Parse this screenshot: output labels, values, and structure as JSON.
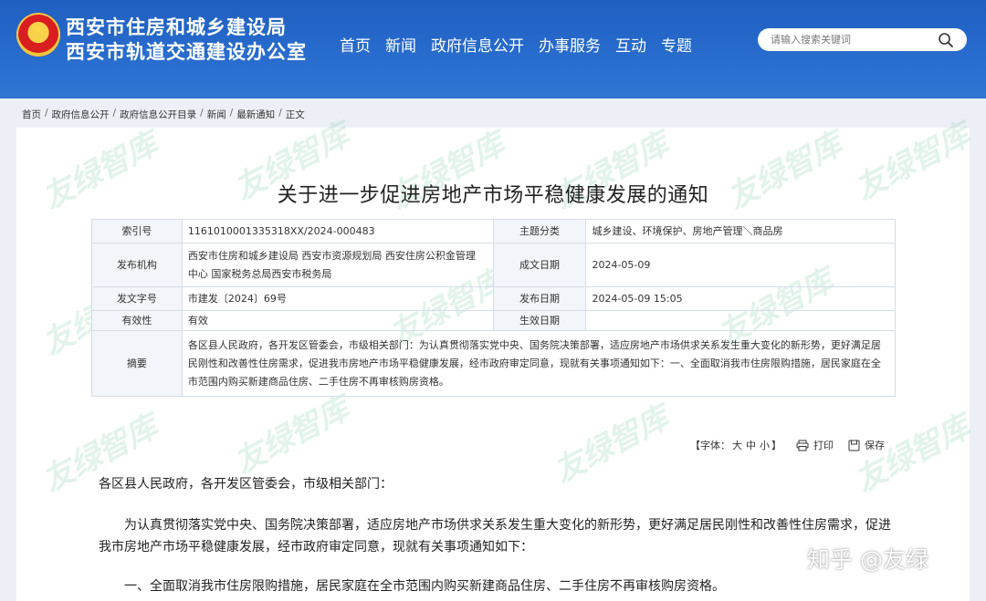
{
  "header": {
    "org_line1": "西安市住房和城乡建设局",
    "org_line2": "西安市轨道交通建设办公室",
    "nav": [
      "首页",
      "新闻",
      "政府信息公开",
      "办事服务",
      "互动",
      "专题"
    ],
    "search_placeholder": "请输入搜索关键词"
  },
  "breadcrumb": [
    "首页",
    "政府信息公开",
    "政府信息公开目录",
    "新闻",
    "最新通知"
  ],
  "breadcrumb_current": "正文",
  "breadcrumb_sep": "/",
  "watermark_text": "友绿智库",
  "title": "关于进一步促进房地产市场平稳健康发展的通知",
  "info": {
    "index_label": "索引号",
    "index_value": "1161010001335318XX/2024-000483",
    "category_label": "主题分类",
    "category_value": "城乡建设、环境保护、房地产管理＼商品房",
    "issuer_label": "发布机构",
    "issuer_value_line1": "西安市住房和城乡建设局 西安市资源规划局 西安住房公积金管理",
    "issuer_value_line2": "中心 国家税务总局西安市税务局",
    "created_label": "成文日期",
    "created_value": "2024-05-09",
    "docno_label": "发文字号",
    "docno_value": "市建发〔2024〕69号",
    "published_label": "发布日期",
    "published_value": "2024-05-09 15:05",
    "validity_label": "有效性",
    "validity_value": "有效",
    "effective_label": "生效日期",
    "effective_value": "",
    "summary_label": "摘要",
    "summary_value": "各区县人民政府，各开发区管委会，市级相关部门：为认真贯彻落实党中央、国务院决策部署，适应房地产市场供求关系发生重大变化的新形势，更好满足居民刚性和改善性住房需求，促进我市房地产市场平稳健康发展，经市政府审定同意，现就有关事项通知如下：一、全面取消我市住房限购措施，居民家庭在全市范围内购买新建商品住房、二手住房不再审核购房资格。"
  },
  "tools": {
    "font_label": "【字体：",
    "font_sizes": [
      "大",
      "中",
      "小"
    ],
    "font_close": "】",
    "print_label": "打印",
    "save_label": "保存"
  },
  "body": {
    "p1": "各区县人民政府，各开发区管委会，市级相关部门：",
    "p2": "为认真贯彻落实党中央、国务院决策部署，适应房地产市场供求关系发生重大变化的新形势，更好满足居民刚性和改善性住房需求，促进我市房地产市场平稳健康发展，经市政府审定同意，现就有关事项通知如下：",
    "p3": "一、全面取消我市住房限购措施，居民家庭在全市范围内购买新建商品住房、二手住房不再审核购房资格。"
  },
  "zhihu_watermark": "知乎 @友绿",
  "colors": {
    "header_bg": "#2466c6",
    "page_bg": "#ecf0f6",
    "table_key_bg": "#f2f5f9"
  }
}
